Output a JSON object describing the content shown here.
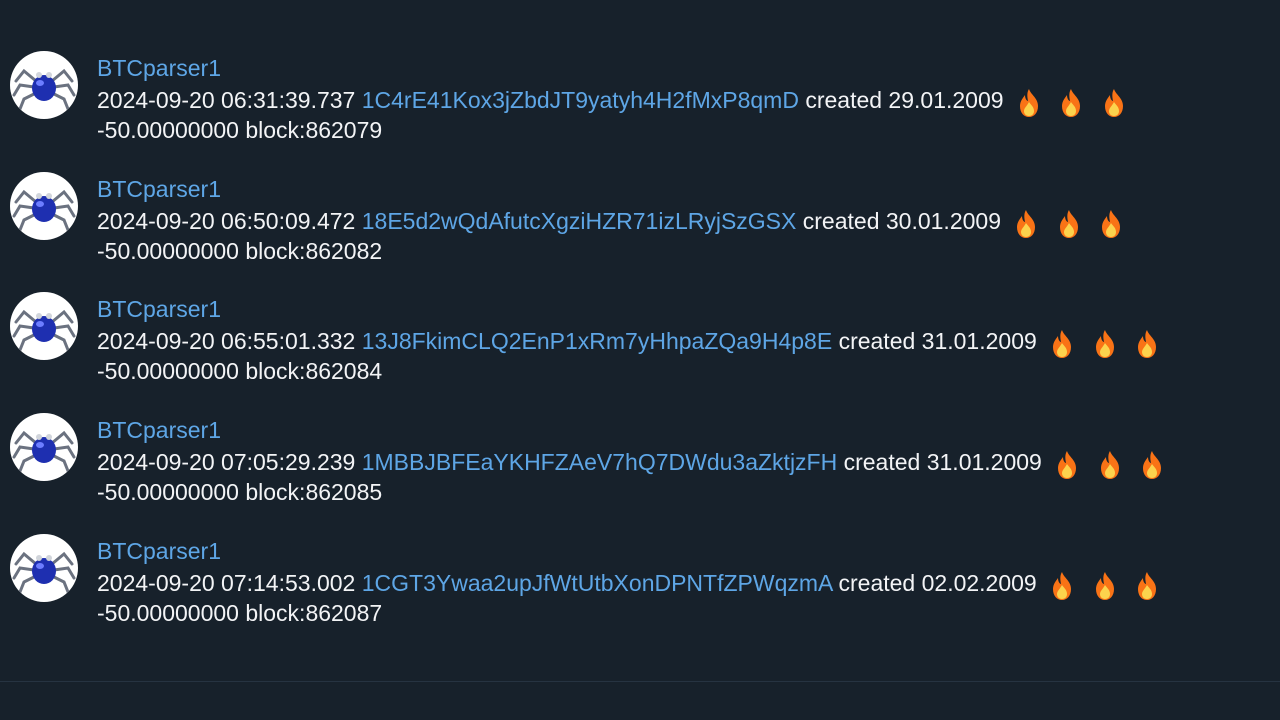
{
  "messages": [
    {
      "sender": "BTCparser1",
      "timestamp": "2024-09-20 06:31:39.737",
      "address": "1C4rE41Kox3jZbdJT9yatyh4H2fMxP8qmD",
      "created_label": "created 29.01.2009",
      "amount_block": "-50.00000000 block:862079"
    },
    {
      "sender": "BTCparser1",
      "timestamp": "2024-09-20 06:50:09.472",
      "address": "18E5d2wQdAfutcXgziHZR71izLRyjSzGSX",
      "created_label": "created 30.01.2009",
      "amount_block": "-50.00000000 block:862082"
    },
    {
      "sender": "BTCparser1",
      "timestamp": "2024-09-20 06:55:01.332",
      "address": "13J8FkimCLQ2EnP1xRm7yHhpaZQa9H4p8E",
      "created_label": "created 31.01.2009",
      "amount_block": "-50.00000000 block:862084"
    },
    {
      "sender": "BTCparser1",
      "timestamp": "2024-09-20 07:05:29.239",
      "address": "1MBBJBFEaYKHFZAeV7hQ7DWdu3aZktjzFH",
      "created_label": "created 31.01.2009",
      "amount_block": "-50.00000000 block:862085"
    },
    {
      "sender": "BTCparser1",
      "timestamp": "2024-09-20 07:14:53.002",
      "address": "1CGT3Ywaa2upJfWtUtbXonDPNTfZPWqzmA",
      "created_label": "created 02.02.2009",
      "amount_block": "-50.00000000 block:862087"
    }
  ],
  "icons": {
    "avatar": "spider-robot-avatar",
    "reaction": "fire-emoji"
  },
  "colors": {
    "background": "#17212b",
    "link": "#5ea6e6",
    "text": "#f3f4f6"
  }
}
